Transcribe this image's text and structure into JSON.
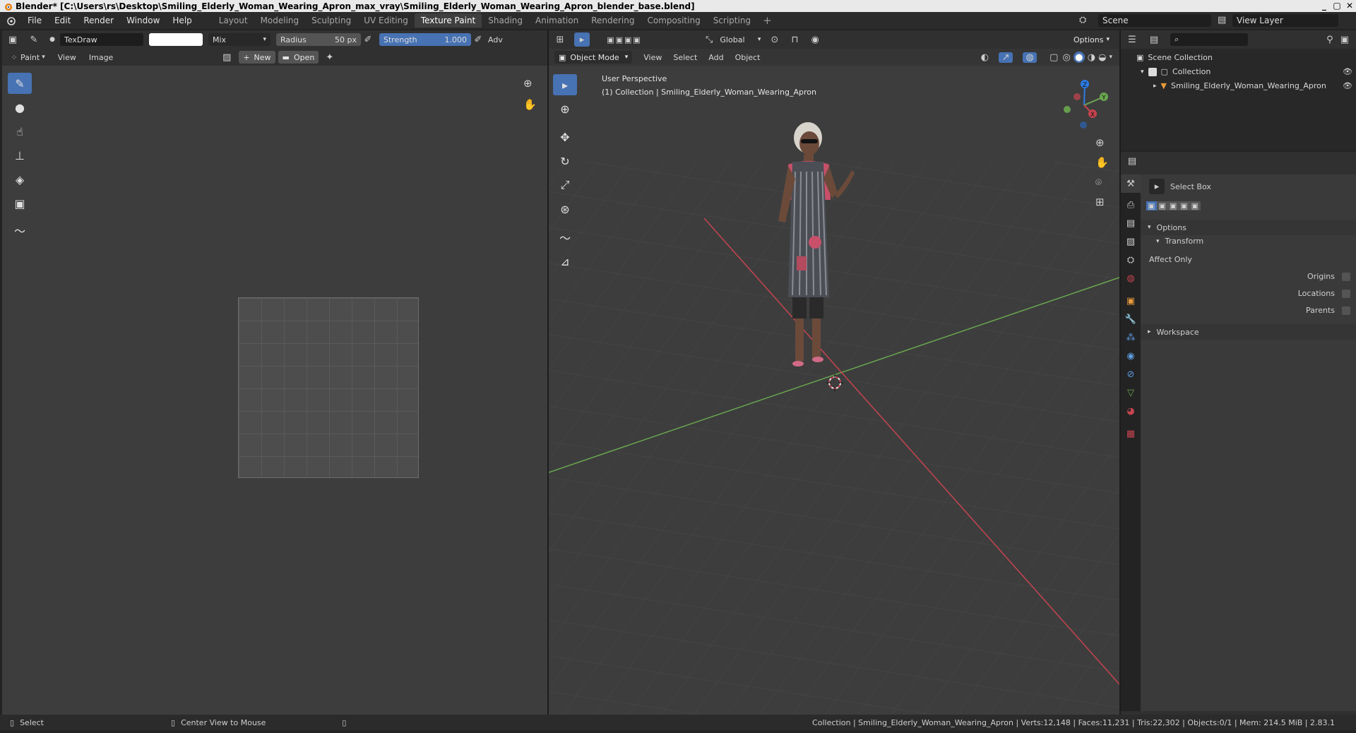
{
  "window": {
    "title": "Blender* [C:\\Users\\rs\\Desktop\\Smiling_Elderly_Woman_Wearing_Apron_max_vray\\Smiling_Elderly_Woman_Wearing_Apron_blender_base.blend]"
  },
  "menu": [
    "File",
    "Edit",
    "Render",
    "Window",
    "Help"
  ],
  "workspaces": [
    "Layout",
    "Modeling",
    "Sculpting",
    "UV Editing",
    "Texture Paint",
    "Shading",
    "Animation",
    "Rendering",
    "Compositing",
    "Scripting"
  ],
  "active_workspace": "Texture Paint",
  "scene": "Scene",
  "view_layer": "View Layer",
  "image_editor": {
    "brush_name": "TexDraw",
    "blend_mode": "Mix",
    "radius_label": "Radius",
    "radius_value": "50 px",
    "strength_label": "Strength",
    "strength_value": "1.000",
    "adv_label": "Adv",
    "mode": "Paint",
    "menu_view": "View",
    "menu_image": "Image",
    "new_label": "New",
    "open_label": "Open"
  },
  "viewport": {
    "orientation": "Global",
    "options_label": "Options",
    "mode": "Object Mode",
    "menu_view": "View",
    "menu_select": "Select",
    "menu_add": "Add",
    "menu_object": "Object",
    "overlay_line1": "User Perspective",
    "overlay_line2": "(1) Collection | Smiling_Elderly_Woman_Wearing_Apron",
    "gizmo_x": "X",
    "gizmo_y": "Y",
    "gizmo_z": "Z"
  },
  "outliner": {
    "root": "Scene Collection",
    "collection": "Collection",
    "object": "Smiling_Elderly_Woman_Wearing_Apron"
  },
  "properties": {
    "tool_name": "Select Box",
    "options_label": "Options",
    "transform_label": "Transform",
    "affect_only": "Affect Only",
    "origins": "Origins",
    "locations": "Locations",
    "parents": "Parents",
    "workspace": "Workspace"
  },
  "statusbar": {
    "select": "Select",
    "center_view": "Center View to Mouse",
    "stats": "Collection | Smiling_Elderly_Woman_Wearing_Apron | Verts:12,148 | Faces:11,231 | Tris:22,302 | Objects:0/1 | Mem: 214.5 MiB | 2.83.1"
  },
  "colors": {
    "accent": "#4772b3",
    "axis_x": "#c6444f",
    "axis_y": "#6aa84f"
  }
}
